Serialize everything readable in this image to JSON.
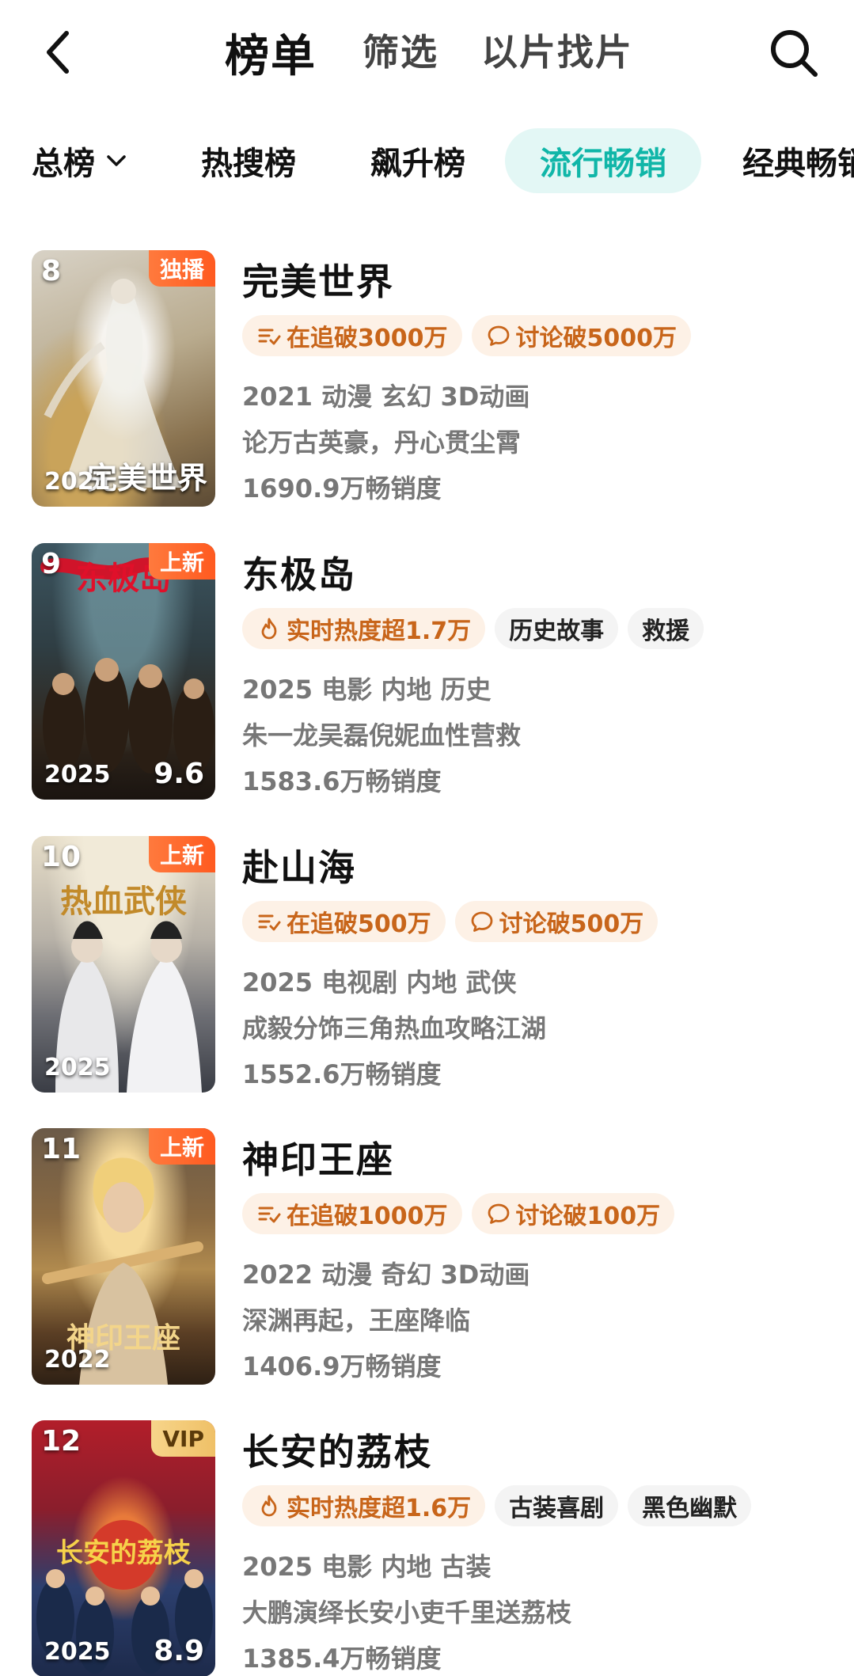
{
  "header": {
    "tabs": [
      "榜单",
      "筛选",
      "以片找片"
    ]
  },
  "categories": {
    "dropdown_label": "总榜",
    "items": [
      "热搜榜",
      "飙升榜",
      "流行畅销",
      "经典畅销"
    ],
    "active": "流行畅销"
  },
  "list": [
    {
      "rank": "8",
      "badge": "独播",
      "year": "2021",
      "score": "",
      "poster_title": "完美世界",
      "title": "完美世界",
      "tags": [
        {
          "icon": "follow-icon",
          "text": "在追破3000万"
        },
        {
          "icon": "comment-icon",
          "text": "讨论破5000万"
        }
      ],
      "meta": "2021 动漫 玄幻 3D动画",
      "desc": "论万古英豪，丹心贯尘霄",
      "sales": "1690.9万畅销度"
    },
    {
      "rank": "9",
      "badge": "上新",
      "year": "2025",
      "score": "9.6",
      "poster_title": "东极岛",
      "title": "东极岛",
      "tags": [
        {
          "icon": "flame-icon",
          "text": "实时热度超1.7万"
        },
        {
          "icon": "",
          "text": "历史故事"
        },
        {
          "icon": "",
          "text": "救援"
        }
      ],
      "meta": "2025 电影 内地 历史",
      "desc": "朱一龙吴磊倪妮血性营救",
      "sales": "1583.6万畅销度"
    },
    {
      "rank": "10",
      "badge": "上新",
      "year": "2025",
      "score": "",
      "poster_title": "热血武侠",
      "title": "赴山海",
      "tags": [
        {
          "icon": "follow-icon",
          "text": "在追破500万"
        },
        {
          "icon": "comment-icon",
          "text": "讨论破500万"
        }
      ],
      "meta": "2025 电视剧 内地 武侠",
      "desc": "成毅分饰三角热血攻略江湖",
      "sales": "1552.6万畅销度"
    },
    {
      "rank": "11",
      "badge": "上新",
      "year": "2022",
      "score": "",
      "poster_title": "神印王座",
      "title": "神印王座",
      "tags": [
        {
          "icon": "follow-icon",
          "text": "在追破1000万"
        },
        {
          "icon": "comment-icon",
          "text": "讨论破100万"
        }
      ],
      "meta": "2022 动漫 奇幻 3D动画",
      "desc": "深渊再起，王座降临",
      "sales": "1406.9万畅销度"
    },
    {
      "rank": "12",
      "badge": "VIP",
      "year": "2025",
      "score": "8.9",
      "poster_title": "长安的荔枝",
      "title": "长安的荔枝",
      "tags": [
        {
          "icon": "flame-icon",
          "text": "实时热度超1.6万"
        },
        {
          "icon": "",
          "text": "古装喜剧"
        },
        {
          "icon": "",
          "text": "黑色幽默"
        }
      ],
      "meta": "2025 电影 内地 古装",
      "desc": "大鹏演绎长安小吏千里送荔枝",
      "sales": "1385.4万畅销度"
    }
  ]
}
